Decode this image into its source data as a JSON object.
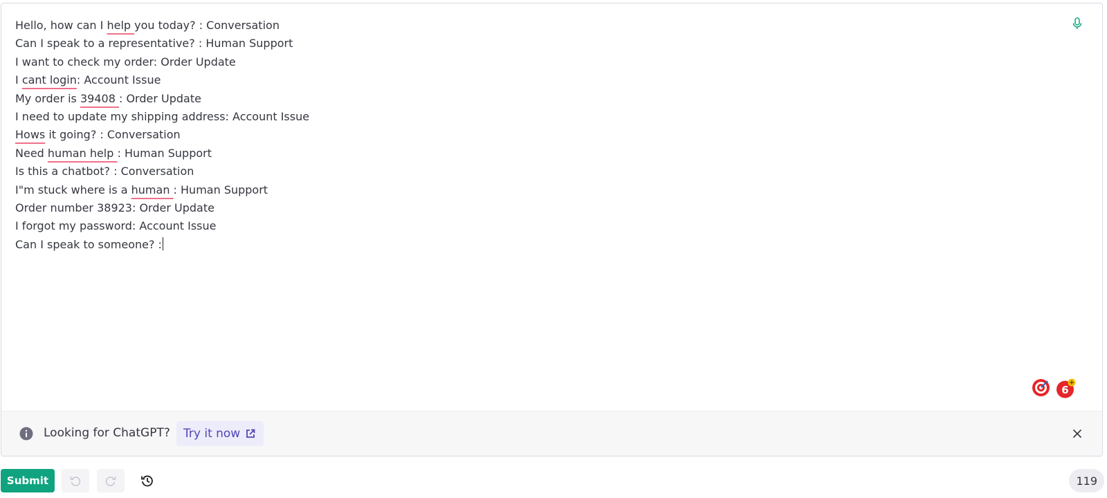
{
  "editor": {
    "lines": [
      "Hello, how can I help you today? : Conversation",
      "Can I speak to a representative? : Human Support",
      "I want to check my order: Order Update",
      "I cant login: Account Issue",
      "My order is 39408 : Order Update",
      "I need to update my shipping address: Account Issue",
      "Hows it going? : Conversation",
      "Need human help : Human Support",
      "Is this a chatbot? : Conversation",
      "I\"m stuck where is a human : Human Support",
      "Order number 38923: Order Update",
      "I forgot my password: Account Issue",
      "Can I speak to someone? :"
    ],
    "misspelled": [
      "cant login",
      "39408 ",
      "Hows",
      "help ",
      "human "
    ]
  },
  "banner": {
    "text": "Looking for ChatGPT?",
    "link_label": "Try it now"
  },
  "toolbar": {
    "submit_label": "Submit",
    "token_count": "119"
  },
  "icons": {
    "mic": "microphone-icon",
    "info": "info-icon",
    "external": "external-link-icon",
    "close": "close-icon",
    "undo": "undo-icon",
    "redo": "redo-icon",
    "history": "history-icon",
    "extension_1": "target-extension-icon",
    "extension_2": "six-plus-extension-icon"
  },
  "colors": {
    "accent": "#10a37f",
    "link": "#5046b5",
    "spellcheck": "#ef6f8a",
    "extension_red": "#e5252a"
  }
}
